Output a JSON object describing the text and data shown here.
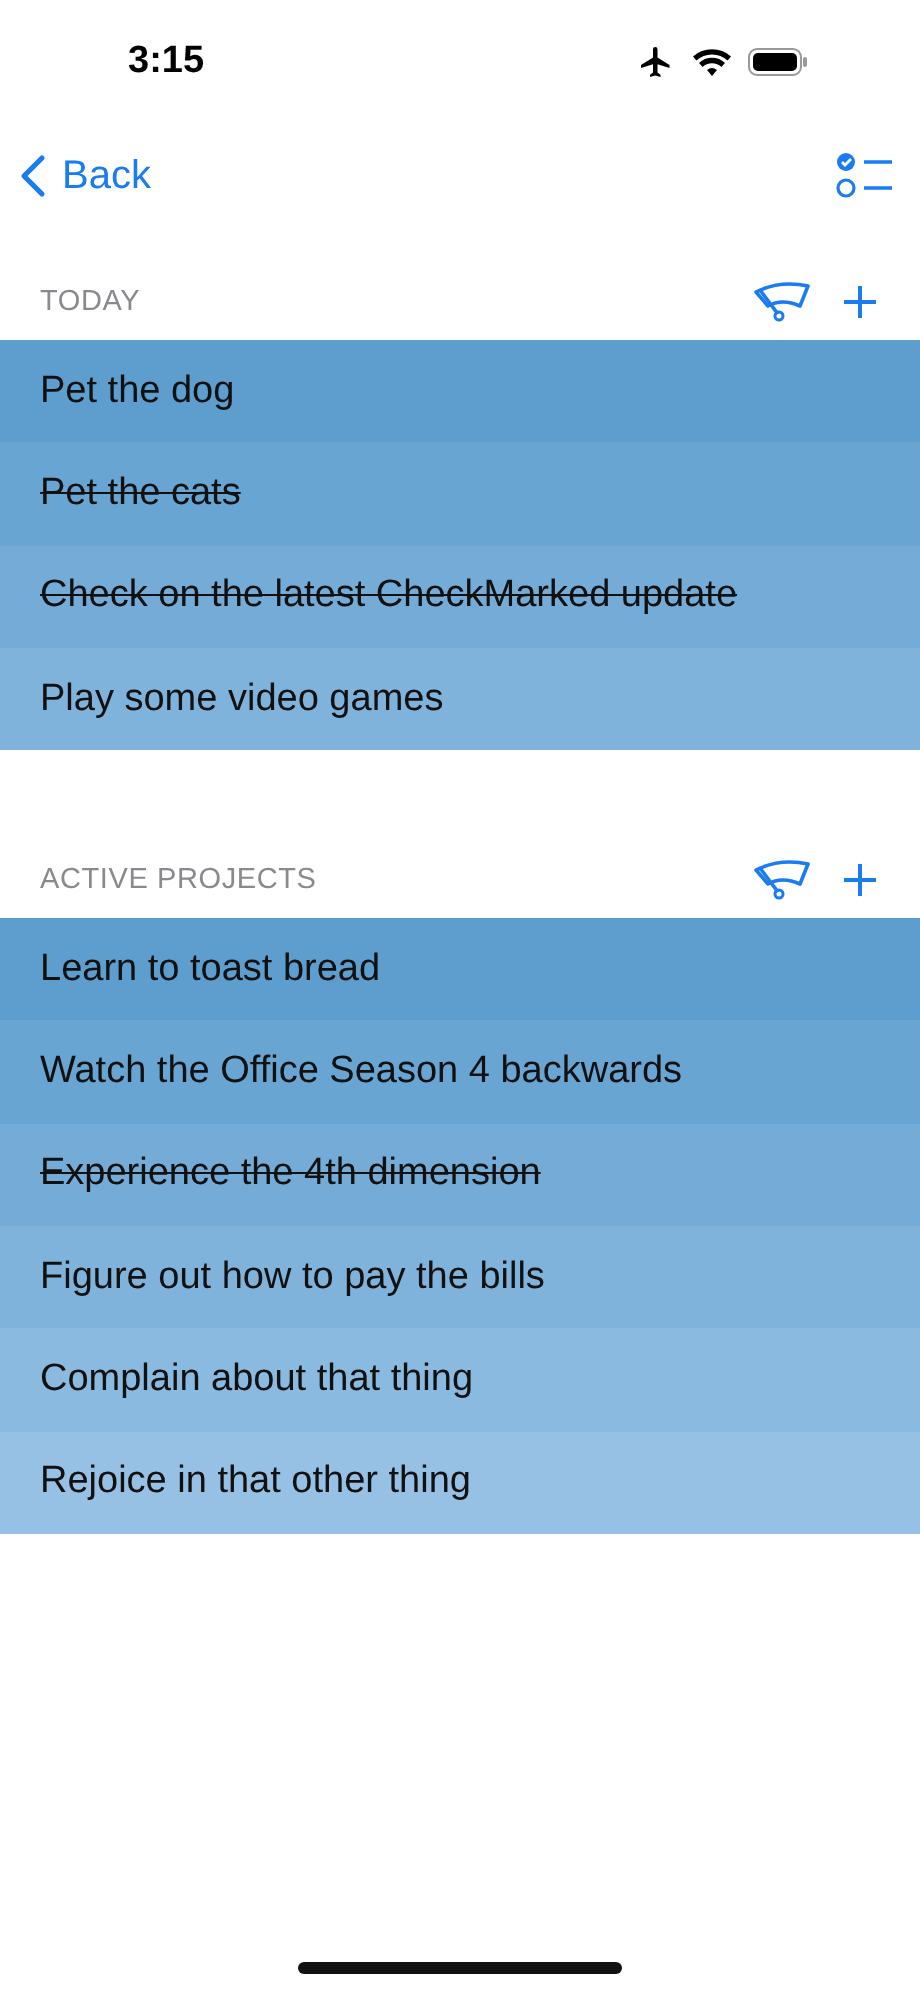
{
  "status_bar": {
    "time": "3:15"
  },
  "nav": {
    "back": "Back"
  },
  "sections": [
    {
      "title": "TODAY",
      "items": [
        {
          "text": "Pet the dog",
          "completed": false
        },
        {
          "text": "Pet the cats",
          "completed": true
        },
        {
          "text": "Check on the latest CheckMarked update",
          "completed": true
        },
        {
          "text": "Play some video games",
          "completed": false
        }
      ]
    },
    {
      "title": "ACTIVE PROJECTS",
      "items": [
        {
          "text": "Learn to toast bread",
          "completed": false
        },
        {
          "text": "Watch the Office Season 4 backwards",
          "completed": false
        },
        {
          "text": "Experience the 4th dimension",
          "completed": true
        },
        {
          "text": "Figure out how to pay the bills",
          "completed": false
        },
        {
          "text": "Complain about that thing",
          "completed": false
        },
        {
          "text": "Rejoice in that other thing",
          "completed": false
        }
      ]
    }
  ]
}
